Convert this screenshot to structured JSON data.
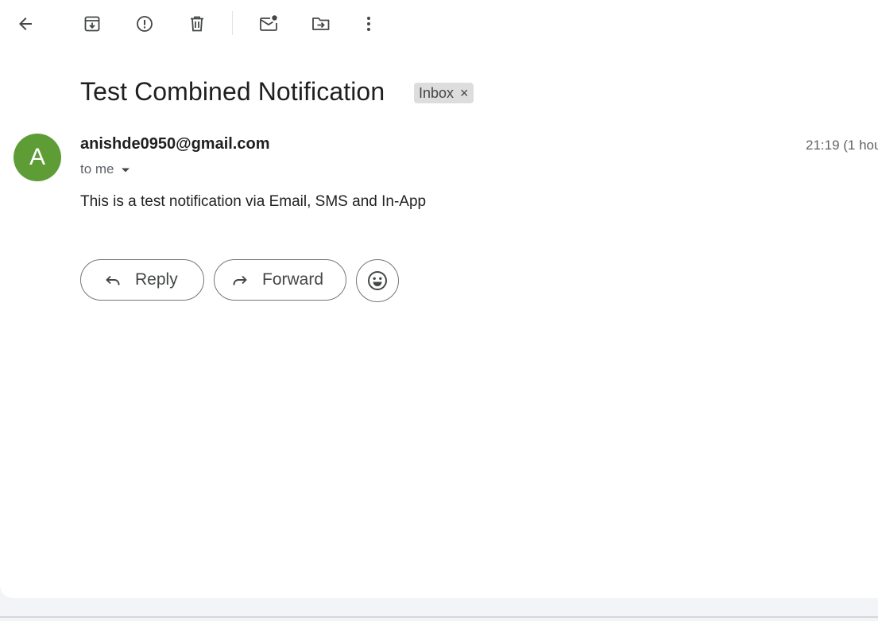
{
  "toolbar": {
    "back_icon": "arrow-left-icon",
    "archive_icon": "archive-icon",
    "spam_icon": "report-spam-icon",
    "delete_icon": "trash-icon",
    "mark_unread_icon": "mail-unread-icon",
    "move_icon": "move-to-folder-icon",
    "more_icon": "more-vertical-icon"
  },
  "message": {
    "subject": "Test Combined Notification",
    "label": "Inbox",
    "label_remove": "×",
    "sender_initial": "A",
    "avatar_color": "#5e9c36",
    "sender": "anishde0950@gmail.com",
    "recipient": "to me",
    "timestamp": "21:19 (1 hou",
    "body": "This is a test notification via Email, SMS and In-App"
  },
  "actions": {
    "reply": "Reply",
    "forward": "Forward",
    "emoji_icon": "smiley-icon"
  }
}
